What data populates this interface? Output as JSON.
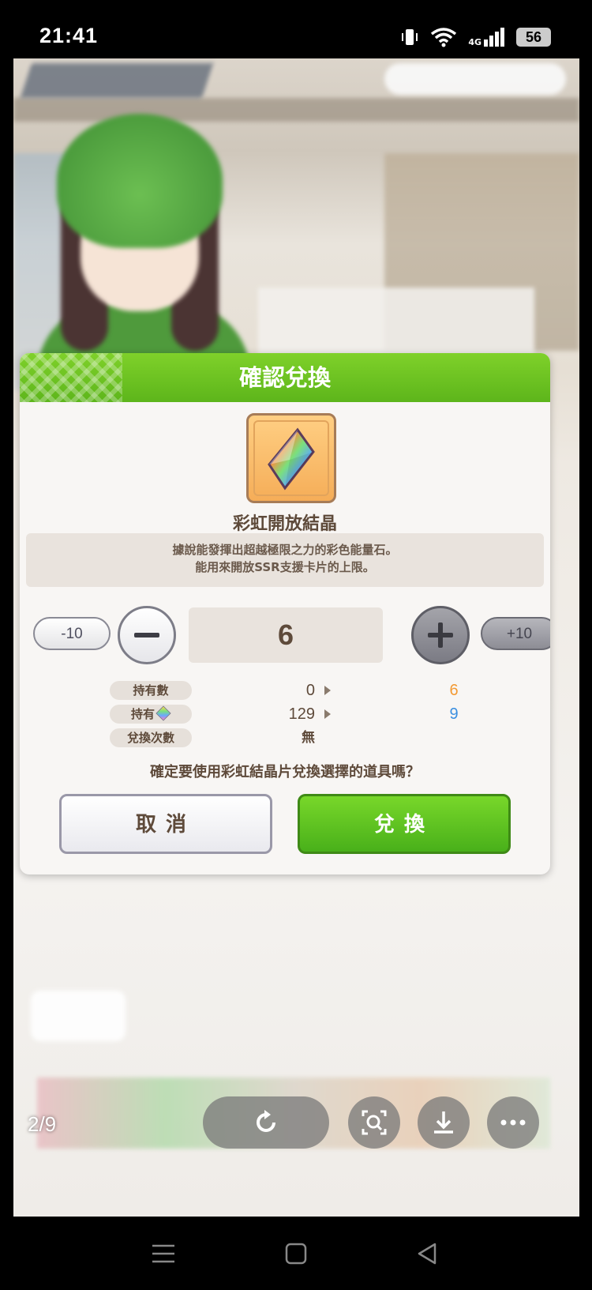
{
  "status_bar": {
    "time": "21:41",
    "network": "4G",
    "battery": "56"
  },
  "dialog": {
    "title": "確認兌換",
    "item_name": "彩虹開放結晶",
    "description_line1": "據說能發揮出超越極限之力的彩色能量石。",
    "description_line2": "能用來開放SSR支援卡片的上限。",
    "minus10_label": "-10",
    "plus10_label": "+10",
    "quantity": "6",
    "info_rows": [
      {
        "label": "持有數",
        "current": "0",
        "after": "6",
        "after_color": "#f39a33"
      },
      {
        "label": "持有",
        "current": "129",
        "after": "9",
        "after_color": "#3b8fe0"
      },
      {
        "label": "兌換次數",
        "current": "無",
        "after": ""
      }
    ],
    "confirm_text": "確定要使用彩虹結晶片兌換選擇的道具嗎？",
    "cancel_label": "取消",
    "exchange_label": "兌換"
  },
  "viewer": {
    "page_counter": "2/9"
  },
  "colors": {
    "header_green": "#6cc421",
    "exchange_green": "#5ec020",
    "text_brown": "#5e4a3a"
  },
  "icons": [
    "wifi-icon",
    "signal-icon",
    "vibrate-icon",
    "refresh-icon",
    "lens-search-icon",
    "download-icon",
    "more-icon",
    "menu-nav-icon",
    "home-nav-icon",
    "back-nav-icon"
  ]
}
